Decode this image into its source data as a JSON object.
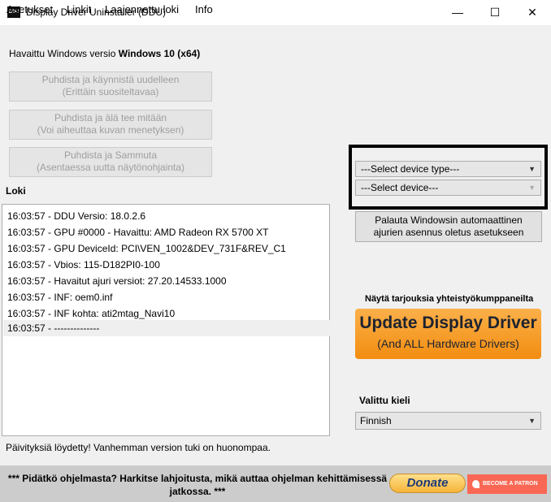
{
  "window": {
    "title": "Display Driver Uninstaller (DDU)",
    "icon_text": "DDU",
    "minimize": "—",
    "maximize": "☐",
    "close": "✕"
  },
  "menu": [
    "Asetukset",
    "Linkit",
    "Laajennettu loki",
    "Info"
  ],
  "version_line": {
    "prefix": "Havaittu Windows versio ",
    "version": "Windows 10 (x64)"
  },
  "action_buttons": [
    {
      "line1": "Puhdista ja käynnistä uudelleen",
      "line2": "(Erittäin suositeltavaa)"
    },
    {
      "line1": "Puhdista ja älä tee mitään",
      "line2": "(Voi aiheuttaa kuvan menetyksen)"
    },
    {
      "line1": "Puhdista ja Sammuta",
      "line2": "(Asentaessa uutta näytönohjainta)"
    }
  ],
  "log": {
    "label": "Loki",
    "entries": [
      "16:03:57 - DDU Versio: 18.0.2.6",
      "16:03:57 - GPU #0000 - Havaittu: AMD Radeon RX 5700 XT",
      "16:03:57 - GPU DeviceId: PCI\\VEN_1002&DEV_731F&REV_C1",
      "16:03:57 - Vbios: 115-D182PI0-100",
      "16:03:57 - Havaitut ajuri versiot: 27.20.14533.1000",
      "16:03:57 - INF: oem0.inf",
      "16:03:57 - INF kohta: ati2mtag_Navi10",
      "16:03:57 - --------------"
    ]
  },
  "update_status": "Päivityksiä löydetty! Vanhemman version tuki on huonompaa.",
  "device_type_select": {
    "value": "---Select device type---"
  },
  "device_select": {
    "value": "---Select device---"
  },
  "restore_button": {
    "line1": "Palauta Windowsin automaattinen",
    "line2": "ajurien asennus oletus asetukseen"
  },
  "partner": {
    "label": "Näytä tarjouksia yhteistyökumppaneilta",
    "ad_title": "Update Display Driver",
    "ad_subtitle": "(And ALL Hardware Drivers)"
  },
  "language": {
    "label": "Valittu kieli",
    "value": "Finnish"
  },
  "footer": {
    "text": "*** Pidätkö ohjelmasta? Harkitse lahjoitusta, mikä auttaa ohjelman kehittämisessä jatkossa. ***",
    "donate_label": "Donate",
    "patron_label": "BECOME A PATRON"
  }
}
